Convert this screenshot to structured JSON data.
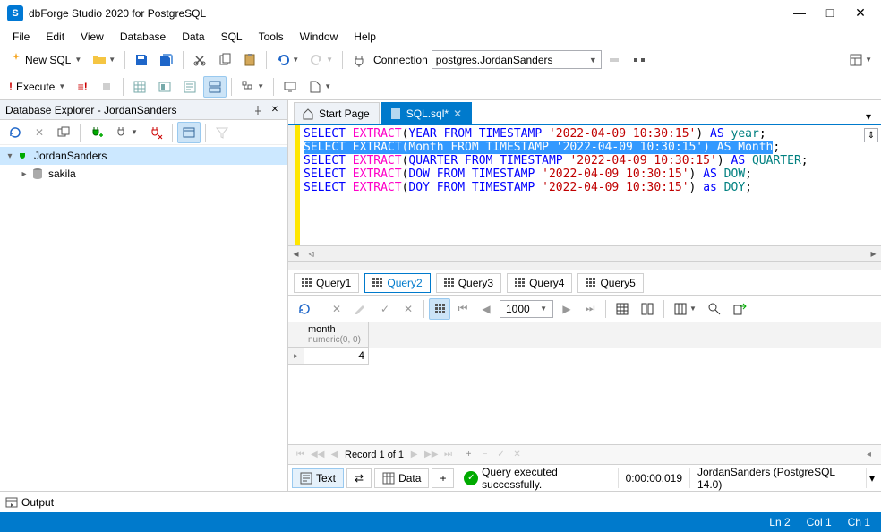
{
  "app": {
    "title": "dbForge Studio 2020 for PostgreSQL"
  },
  "menu": [
    "File",
    "Edit",
    "View",
    "Database",
    "Data",
    "SQL",
    "Tools",
    "Window",
    "Help"
  ],
  "toolbar1": {
    "newsql": "New SQL",
    "connection_label": "Connection",
    "connection_value": "postgres.JordanSanders"
  },
  "toolbar2": {
    "execute": "Execute"
  },
  "explorer": {
    "title": "Database Explorer - JordanSanders",
    "root": "JordanSanders",
    "child": "sakila"
  },
  "doctabs": {
    "start": "Start Page",
    "sql": "SQL.sql*"
  },
  "code": {
    "lines": [
      [
        {
          "t": "SELECT",
          "c": "k"
        },
        {
          "t": " "
        },
        {
          "t": "EXTRACT",
          "c": "f"
        },
        {
          "t": "("
        },
        {
          "t": "YEAR",
          "c": "k"
        },
        {
          "t": " "
        },
        {
          "t": "FROM",
          "c": "k"
        },
        {
          "t": " "
        },
        {
          "t": "TIMESTAMP",
          "c": "k"
        },
        {
          "t": " "
        },
        {
          "t": "'2022-04-09 10:30:15'",
          "c": "s"
        },
        {
          "t": ") "
        },
        {
          "t": "AS",
          "c": "k"
        },
        {
          "t": " "
        },
        {
          "t": "year",
          "c": "id"
        },
        {
          "t": ";"
        }
      ],
      [
        {
          "t": "SELECT EXTRACT(Month FROM TIMESTAMP '2022-04-09 10:30:15') AS Month",
          "c": "sel"
        },
        {
          "t": ";"
        }
      ],
      [
        {
          "t": "SELECT",
          "c": "k"
        },
        {
          "t": " "
        },
        {
          "t": "EXTRACT",
          "c": "f"
        },
        {
          "t": "("
        },
        {
          "t": "QUARTER",
          "c": "k"
        },
        {
          "t": " "
        },
        {
          "t": "FROM",
          "c": "k"
        },
        {
          "t": " "
        },
        {
          "t": "TIMESTAMP",
          "c": "k"
        },
        {
          "t": " "
        },
        {
          "t": "'2022-04-09 10:30:15'",
          "c": "s"
        },
        {
          "t": ") "
        },
        {
          "t": "AS",
          "c": "k"
        },
        {
          "t": " "
        },
        {
          "t": "QUARTER",
          "c": "id"
        },
        {
          "t": ";"
        }
      ],
      [
        {
          "t": "SELECT",
          "c": "k"
        },
        {
          "t": " "
        },
        {
          "t": "EXTRACT",
          "c": "f"
        },
        {
          "t": "("
        },
        {
          "t": "DOW",
          "c": "k"
        },
        {
          "t": " "
        },
        {
          "t": "FROM",
          "c": "k"
        },
        {
          "t": " "
        },
        {
          "t": "TIMESTAMP",
          "c": "k"
        },
        {
          "t": " "
        },
        {
          "t": "'2022-04-09 10:30:15'",
          "c": "s"
        },
        {
          "t": ") "
        },
        {
          "t": "AS",
          "c": "k"
        },
        {
          "t": " "
        },
        {
          "t": "DOW",
          "c": "id"
        },
        {
          "t": ";"
        }
      ],
      [
        {
          "t": "SELECT",
          "c": "k"
        },
        {
          "t": " "
        },
        {
          "t": "EXTRACT",
          "c": "f"
        },
        {
          "t": "("
        },
        {
          "t": "DOY",
          "c": "k"
        },
        {
          "t": " "
        },
        {
          "t": "FROM",
          "c": "k"
        },
        {
          "t": " "
        },
        {
          "t": "TIMESTAMP",
          "c": "k"
        },
        {
          "t": " "
        },
        {
          "t": "'2022-04-09 10:30:15'",
          "c": "s"
        },
        {
          "t": ") "
        },
        {
          "t": "as",
          "c": "k"
        },
        {
          "t": " "
        },
        {
          "t": "DOY",
          "c": "id"
        },
        {
          "t": ";"
        }
      ]
    ]
  },
  "querytabs": [
    "Query1",
    "Query2",
    "Query3",
    "Query4",
    "Query5"
  ],
  "grid": {
    "col_name": "month",
    "col_type": "numeric(0, 0)",
    "value": "4",
    "page_size": "1000",
    "record": "Record 1 of 1"
  },
  "bottombar": {
    "text_mode": "Text",
    "data_mode": "Data",
    "status": "Query executed successfully.",
    "time": "0:00:00.019",
    "conn": "JordanSanders (PostgreSQL 14.0)"
  },
  "output": {
    "label": "Output"
  },
  "status": {
    "ln": "Ln 2",
    "col": "Col 1",
    "ch": "Ch 1"
  }
}
